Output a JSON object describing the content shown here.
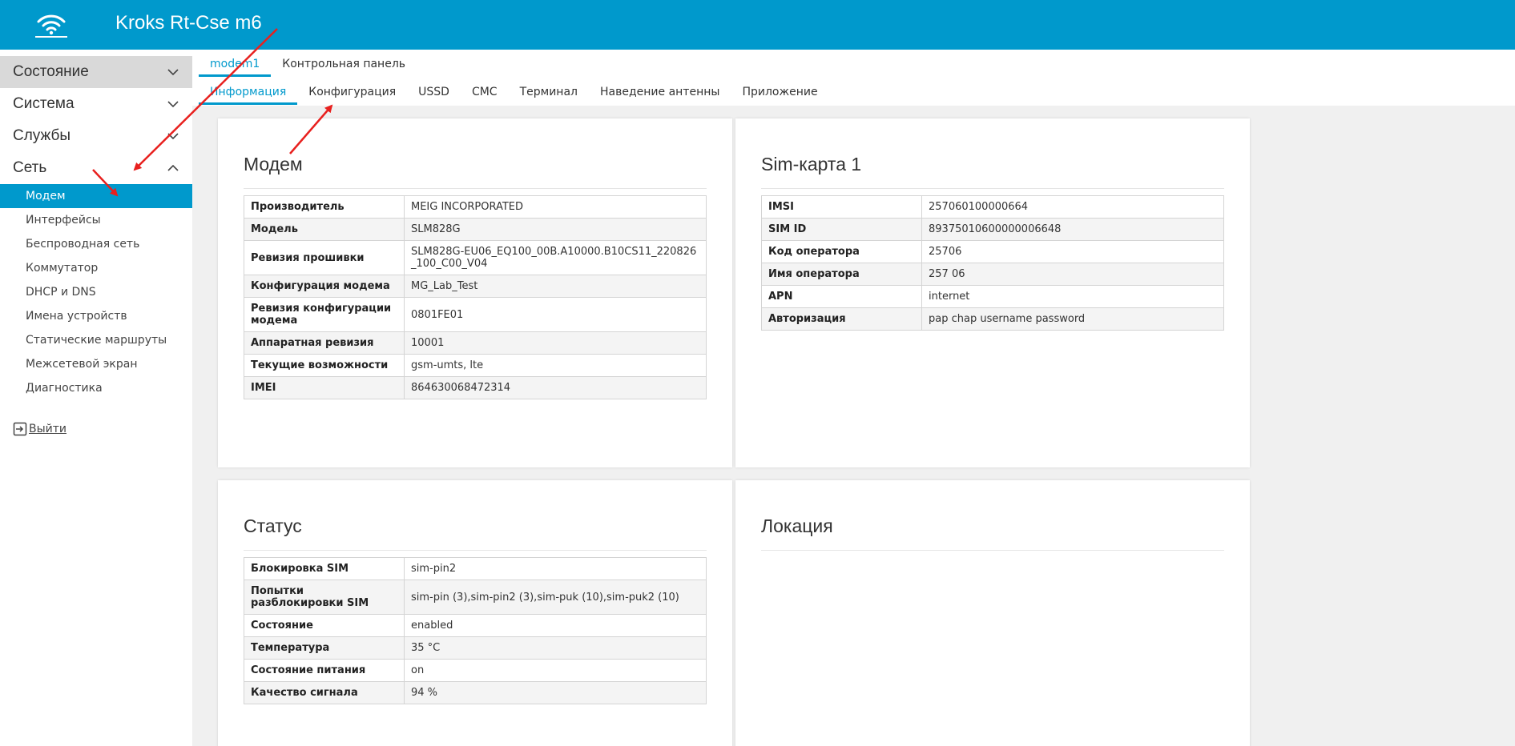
{
  "app": {
    "title": "Kroks Rt-Cse m6"
  },
  "sidebar": {
    "groups": [
      {
        "label": "Состояние"
      },
      {
        "label": "Система"
      },
      {
        "label": "Службы"
      },
      {
        "label": "Сеть"
      }
    ],
    "network_items": [
      {
        "label": "Модем"
      },
      {
        "label": "Интерфейсы"
      },
      {
        "label": "Беспроводная сеть"
      },
      {
        "label": "Коммутатор"
      },
      {
        "label": "DHCP и DNS"
      },
      {
        "label": "Имена устройств"
      },
      {
        "label": "Статические маршруты"
      },
      {
        "label": "Межсетевой экран"
      },
      {
        "label": "Диагностика"
      }
    ],
    "logout": "Выйти"
  },
  "tabs": {
    "top": [
      "modem1",
      "Контрольная панель"
    ],
    "bottom": [
      "Информация",
      "Конфигурация",
      "USSD",
      "СМС",
      "Терминал",
      "Наведение антенны",
      "Приложение"
    ]
  },
  "modem": {
    "title": "Модем",
    "rows": [
      {
        "k": "Производитель",
        "v": "MEIG INCORPORATED"
      },
      {
        "k": "Модель",
        "v": "SLM828G"
      },
      {
        "k": "Ревизия прошивки",
        "v": "SLM828G-EU06_EQ100_00B.A10000.B10CS11_220826_100_C00_V04"
      },
      {
        "k": "Конфигурация модема",
        "v": "MG_Lab_Test"
      },
      {
        "k": "Ревизия конфигурации модема",
        "v": "0801FE01"
      },
      {
        "k": "Аппаратная ревизия",
        "v": "10001"
      },
      {
        "k": "Текущие возможности",
        "v": "gsm-umts, lte"
      },
      {
        "k": "IMEI",
        "v": "864630068472314"
      }
    ]
  },
  "sim": {
    "title": "Sim-карта 1",
    "rows": [
      {
        "k": "IMSI",
        "v": "257060100000664"
      },
      {
        "k": "SIM ID",
        "v": "89375010600000006648"
      },
      {
        "k": "Код оператора",
        "v": "25706"
      },
      {
        "k": "Имя оператора",
        "v": "257 06"
      },
      {
        "k": "APN",
        "v": "internet"
      },
      {
        "k": "Авторизация",
        "v": "pap chap username password"
      }
    ]
  },
  "status": {
    "title": "Статус",
    "rows": [
      {
        "k": "Блокировка SIM",
        "v": "sim-pin2"
      },
      {
        "k": "Попытки разблокировки SIM",
        "v": "sim-pin (3),sim-pin2 (3),sim-puk (10),sim-puk2 (10)"
      },
      {
        "k": "Состояние",
        "v": "enabled"
      },
      {
        "k": "Температура",
        "v": "35 °C"
      },
      {
        "k": "Состояние питания",
        "v": "on"
      },
      {
        "k": "Качество сигнала",
        "v": "94 %"
      }
    ]
  },
  "location": {
    "title": "Локация"
  },
  "colors": {
    "accent": "#0099cc",
    "arrow": "#e8201e"
  }
}
